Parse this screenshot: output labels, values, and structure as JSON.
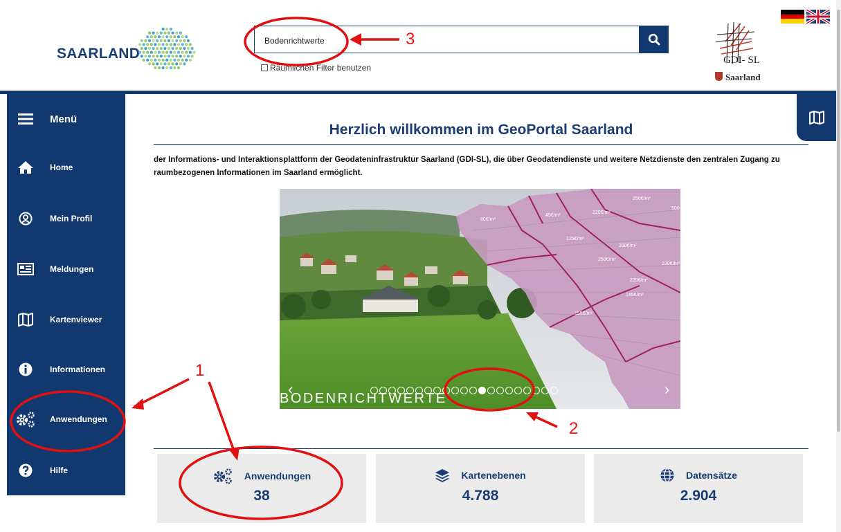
{
  "header": {
    "brand": "SAARLAND",
    "search": {
      "value": "Bodenrichtwerte"
    },
    "filter_label": "Räumlichen Filter benutzen",
    "gdi_text": "GDI- SL",
    "saarland_text": "Saarland"
  },
  "sidebar": {
    "menu_label": "Menü",
    "items": [
      {
        "label": "Home",
        "icon": "home-icon"
      },
      {
        "label": "Mein Profil",
        "icon": "user-circle-icon"
      },
      {
        "label": "Meldungen",
        "icon": "newspaper-icon"
      },
      {
        "label": "Kartenviewer",
        "icon": "map-icon"
      },
      {
        "label": "Informationen",
        "icon": "info-icon"
      },
      {
        "label": "Anwendungen",
        "icon": "cogs-icon"
      },
      {
        "label": "Hilfe",
        "icon": "help-icon"
      }
    ]
  },
  "main": {
    "title": "Herzlich willkommen im GeoPortal Saarland",
    "intro": "der Informations- und Interaktionsplattform der Geodateninfrastruktur Saarland (GDI-SL), die über Geodatendienste und weitere Netzdienste den zentralen Zugang zu raumbezogenen Informationen im Saarland ermöglicht.",
    "carousel": {
      "caption": "BODENRICHTWERTE",
      "price_labels": [
        "250€/m²",
        "500",
        "80€/m²",
        "45€/m²",
        "220€/m²",
        "125€/m²",
        "250€/m²",
        "250€/m²",
        "220€/m²",
        "220€/m²",
        "145€/m²",
        "155€/m²"
      ],
      "slide_count": 21,
      "active_slide": 12
    },
    "stats": [
      {
        "label": "Anwendungen",
        "value": "38",
        "icon": "cogs-icon"
      },
      {
        "label": "Kartenebenen",
        "value": "4.788",
        "icon": "layers-icon"
      },
      {
        "label": "Datensätze",
        "value": "2.904",
        "icon": "globe-icon"
      }
    ]
  },
  "annotations": {
    "numbers": [
      "1",
      "2",
      "3"
    ],
    "color": "#e11111"
  },
  "colors": {
    "brand": "#12396f",
    "accent": "#1c3d73"
  }
}
